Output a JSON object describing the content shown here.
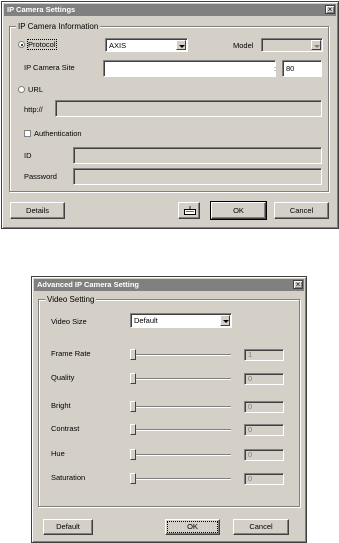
{
  "window1": {
    "title": "IP Camera Settings",
    "close_glyph": "×",
    "group_title": "IP Camera Information",
    "protocol_label": "Protocol",
    "protocol_value": "AXIS",
    "model_label": "Model",
    "model_value": "",
    "site_label": "IP Camera Site",
    "site_value": "",
    "port_separator": ":",
    "port_value": "80",
    "url_label": "URL",
    "http_prefix": "http://",
    "url_value": "",
    "auth_label": "Authentication",
    "id_label": "ID",
    "id_value": "",
    "password_label": "Password",
    "password_value": "",
    "details_button": "Details",
    "keyboard_icon": "keyboard-icon",
    "ok_button": "OK",
    "cancel_button": "Cancel"
  },
  "window2": {
    "title": "Advanced IP Camera Setting",
    "close_glyph": "×",
    "group_title": "Video Setting",
    "video_size_label": "Video Size",
    "video_size_value": "Default",
    "sliders": [
      {
        "label": "Frame Rate",
        "value": "1",
        "position": 0
      },
      {
        "label": "Quality",
        "value": "0",
        "position": 0
      },
      {
        "label": "Bright",
        "value": "0",
        "position": 0
      },
      {
        "label": "Contrast",
        "value": "0",
        "position": 0
      },
      {
        "label": "Hue",
        "value": "0",
        "position": 0
      },
      {
        "label": "Saturation",
        "value": "0",
        "position": 0
      }
    ],
    "default_button": "Default",
    "ok_button": "OK",
    "cancel_button": "Cancel"
  }
}
